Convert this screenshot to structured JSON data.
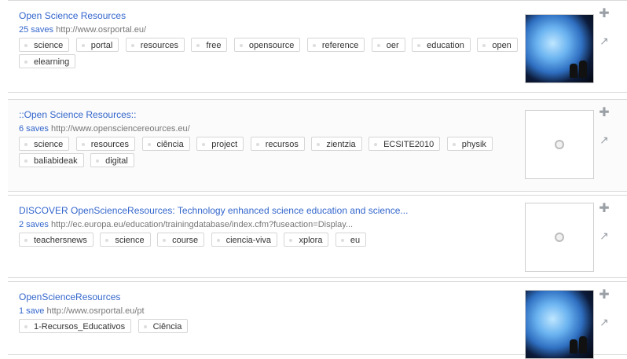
{
  "results": [
    {
      "title": "Open Science Resources",
      "saves": "25 saves",
      "url": "http://www.osrportal.eu/",
      "tags": [
        "science",
        "portal",
        "resources",
        "free",
        "opensource",
        "reference",
        "oer",
        "education",
        "open",
        "elearning"
      ],
      "thumbnail": "globe",
      "actions": {
        "add_icon": "plus-icon",
        "share_icon": "share-icon"
      }
    },
    {
      "title": "::Open Science Resources::",
      "saves": "6 saves",
      "url": "http://www.opensciencereources.eu/",
      "tags": [
        "science",
        "resources",
        "ciência",
        "project",
        "recursos",
        "zientzia",
        "ECSITE2010",
        "physik",
        "baliabideak",
        "digital"
      ],
      "thumbnail": "placeholder",
      "actions": {
        "add_icon": "plus-icon",
        "share_icon": "share-icon"
      }
    },
    {
      "title": "DISCOVER OpenScienceResources: Technology enhanced science education and science...",
      "saves": "2 saves",
      "url": "http://ec.europa.eu/education/trainingdatabase/index.cfm?fuseaction=Display...",
      "tags": [
        "teachersnews",
        "science",
        "course",
        "ciencia-viva",
        "xplora",
        "eu"
      ],
      "thumbnail": "placeholder",
      "actions": {
        "add_icon": "plus-icon",
        "share_icon": "share-icon"
      }
    },
    {
      "title": "OpenScienceResources",
      "saves": "1 save",
      "url": "http://www.osrportal.eu/pt",
      "tags": [
        "1-Recursos_Educativos",
        "Ciência"
      ],
      "thumbnail": "globe",
      "actions": {
        "add_icon": "plus-icon",
        "share_icon": "share-icon"
      }
    }
  ],
  "colors": {
    "link": "#3366cc",
    "meta": "#777777",
    "border": "#d9d9d9"
  }
}
